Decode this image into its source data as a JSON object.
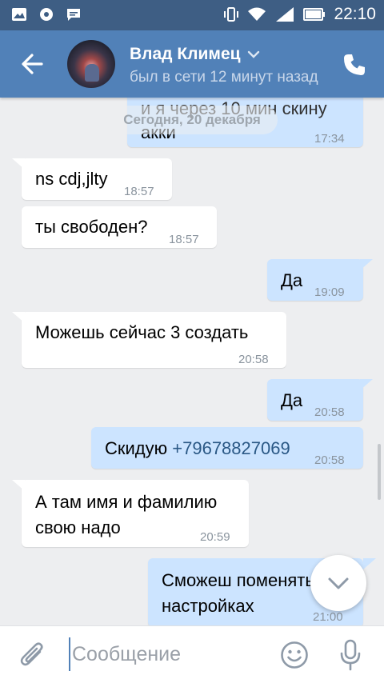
{
  "status_bar": {
    "time": "22:10"
  },
  "header": {
    "contact_name": "Влад Климец",
    "contact_status": "был в сети 12 минут назад"
  },
  "chat": {
    "date_separator": "Сегодня, 20 декабря",
    "messages": [
      {
        "dir": "out",
        "lines": [
          "и я через 10 мин скину",
          "акки"
        ],
        "time": "17:34"
      },
      {
        "dir": "in",
        "lines": [
          "ns cdj,jlty"
        ],
        "time": "18:57"
      },
      {
        "dir": "in",
        "lines": [
          "ты свободен?"
        ],
        "time": "18:57"
      },
      {
        "dir": "out",
        "lines": [
          "Да"
        ],
        "time": "19:09"
      },
      {
        "dir": "in",
        "lines": [
          "Можешь сейчас 3 создать"
        ],
        "time": "20:58"
      },
      {
        "dir": "out",
        "lines": [
          "Да"
        ],
        "time": "20:58"
      },
      {
        "dir": "out",
        "text_prefix": "Скидую ",
        "phone": "+79678827069",
        "time": "20:58"
      },
      {
        "dir": "in",
        "lines": [
          "А там имя и фамилию",
          "свою надо"
        ],
        "time": "20:59"
      },
      {
        "dir": "out",
        "lines": [
          "Сможеш поменять в",
          "настройках"
        ],
        "time": "21:00"
      }
    ]
  },
  "input": {
    "placeholder": "Сообщение",
    "value": ""
  },
  "colors": {
    "header": "#5181b8",
    "status_bar": "#3e5e84",
    "outgoing": "#cce4ff",
    "incoming": "#ffffff",
    "background": "#edeef0"
  },
  "icons": [
    "image-icon",
    "sync-icon",
    "chat-icon",
    "vibrate-icon",
    "wifi-icon",
    "signal-icon",
    "battery-icon",
    "back-arrow-icon",
    "chevron-down-icon",
    "phone-icon",
    "paperclip-icon",
    "emoji-icon",
    "microphone-icon"
  ]
}
